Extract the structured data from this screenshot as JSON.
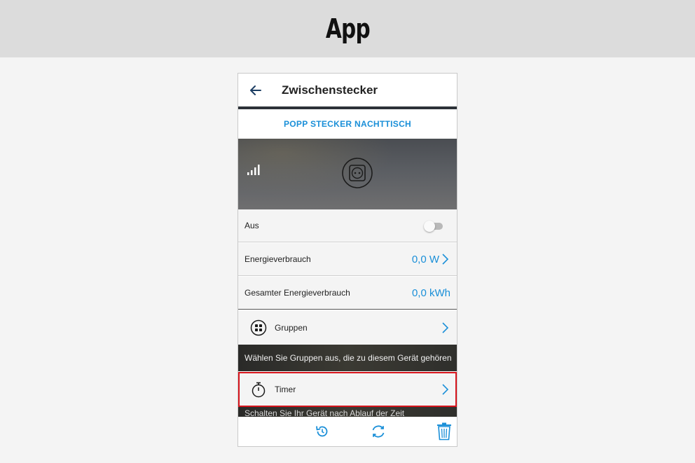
{
  "banner": {
    "title": "App"
  },
  "appbar": {
    "title": "Zwischenstecker",
    "back_icon": "arrow-left-icon"
  },
  "device": {
    "name": "POPP STECKER NACHTTISCH"
  },
  "rows": {
    "switch": {
      "label": "Aus",
      "state": "off"
    },
    "energy": {
      "label": "Energieverbrauch",
      "value": "0,0 W"
    },
    "total_energy": {
      "label": "Gesamter Energieverbrauch",
      "value": "0,0 kWh"
    },
    "groups": {
      "label": "Gruppen",
      "description": "Wählen Sie Gruppen aus, die zu diesem Gerät gehören"
    },
    "timer": {
      "label": "Timer",
      "description": "Schalten Sie Ihr Gerät nach Ablauf der Zeit"
    }
  },
  "bottombar": {
    "icons": [
      "history-icon",
      "refresh-icon",
      "trash-icon"
    ]
  },
  "colors": {
    "accent": "#1a8fd8",
    "highlight": "#d6141c",
    "divider": "#2d3238"
  }
}
